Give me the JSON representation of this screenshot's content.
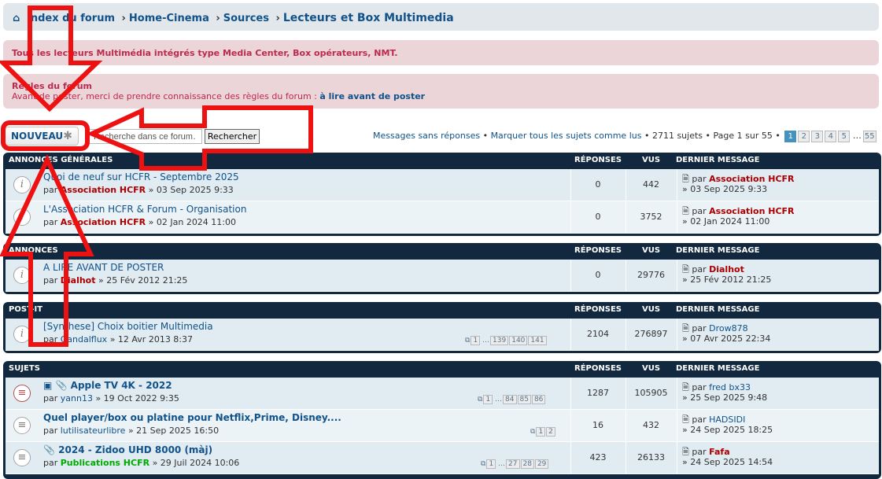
{
  "breadcrumb": {
    "items": [
      "Index du forum",
      "Home-Cinema",
      "Sources"
    ],
    "separator": "›",
    "current": "Lecteurs et Box Multimedia"
  },
  "notice_description": "Tous les lecteurs Multimédia intégrés type Media Center, Box opérateurs, NMT.",
  "rules": {
    "title": "Règles du forum",
    "text": "Avant de poster, merci de prendre connaissance des règles du forum :",
    "link": "à lire avant de poster"
  },
  "toolbar": {
    "new_label": "NOUVEAU",
    "search_placeholder": "Recherche dans ce forum…",
    "search_button": "Rechercher",
    "unanswered": "Messages sans réponses",
    "mark_read": "Marquer tous les sujets comme lus",
    "topic_count": "2711 sujets",
    "page_info": "Page 1 sur 55",
    "pages": [
      "1",
      "2",
      "3",
      "4",
      "5",
      "…",
      "55"
    ]
  },
  "columns": {
    "replies": "RÉPONSES",
    "views": "VUS",
    "last": "DERNIER MESSAGE"
  },
  "sections": [
    {
      "name": "ANNONCES GÉNÉRALES",
      "topics": [
        {
          "title": "Quoi de neuf sur HCFR - Septembre 2025",
          "prefix": "par",
          "author": "Association HCFR",
          "date": "» 03 Sep 2025 9:33",
          "replies": "0",
          "views": "442",
          "last_by": "Association HCFR",
          "last_date": "» 03 Sep 2025 9:33"
        },
        {
          "title": "L'Association HCFR & Forum - Organisation",
          "prefix": "par",
          "author": "Association HCFR",
          "date": "» 02 Jan 2024 11:00",
          "replies": "0",
          "views": "3752",
          "last_by": "Association HCFR",
          "last_date": "» 02 Jan 2024 11:00"
        }
      ]
    },
    {
      "name": "ANNONCES",
      "topics": [
        {
          "title": "A LIRE AVANT DE POSTER",
          "prefix": "par",
          "author": "Dialhot",
          "date": "» 25 Fév 2012 21:25",
          "replies": "0",
          "views": "29776",
          "last_by": "Dialhot",
          "last_date": "» 25 Fév 2012 21:25"
        }
      ]
    },
    {
      "name": "POST-IT",
      "topics": [
        {
          "title": "[Synthese] Choix boitier Multimedia",
          "prefix": "par",
          "author": "Gandalflux",
          "date": "» 12 Avr 2013 8:37",
          "pages": [
            "1",
            "…",
            "139",
            "140",
            "141"
          ],
          "replies": "2104",
          "views": "276897",
          "last_by": "Drow878",
          "last_date": "» 07 Avr 2025 22:34"
        }
      ]
    },
    {
      "name": "SUJETS",
      "topics": [
        {
          "title": "Apple TV 4K - 2022",
          "prefix": "par",
          "author": "yann13",
          "date": "» 19 Oct 2022 9:35",
          "pages": [
            "1",
            "…",
            "84",
            "85",
            "86"
          ],
          "replies": "1287",
          "views": "105905",
          "last_by": "fred bx33",
          "last_date": "» 25 Sep 2025 9:48"
        },
        {
          "title": "Quel player/box ou platine pour Netflix,Prime, Disney....",
          "prefix": "par",
          "author": "lutilisateurlibre",
          "date": "» 21 Sep 2025 16:50",
          "pages": [
            "1",
            "2"
          ],
          "replies": "16",
          "views": "432",
          "last_by": "HADSIDI",
          "last_date": "» 24 Sep 2025 18:25"
        },
        {
          "title": "2024 - Zidoo UHD 8000 (màj)",
          "prefix": "par",
          "author": "Publications HCFR",
          "date": "» 29 Juil 2024 10:06",
          "pages": [
            "1",
            "…",
            "27",
            "28",
            "29"
          ],
          "replies": "423",
          "views": "26133",
          "last_by": "Fafa",
          "last_date": "» 24 Sep 2025 14:54"
        }
      ]
    }
  ],
  "colors": {
    "link": "#105289",
    "header": "#12283e",
    "notice_bg": "#ecd5d8",
    "annotation_red": "#ee1111"
  },
  "icons": [
    "home-icon",
    "plus-icon",
    "info-icon",
    "lock-icon",
    "topic-icon",
    "hot-topic-icon",
    "attachment-icon",
    "last-post-icon",
    "pages-icon",
    "arrow-annotation"
  ]
}
